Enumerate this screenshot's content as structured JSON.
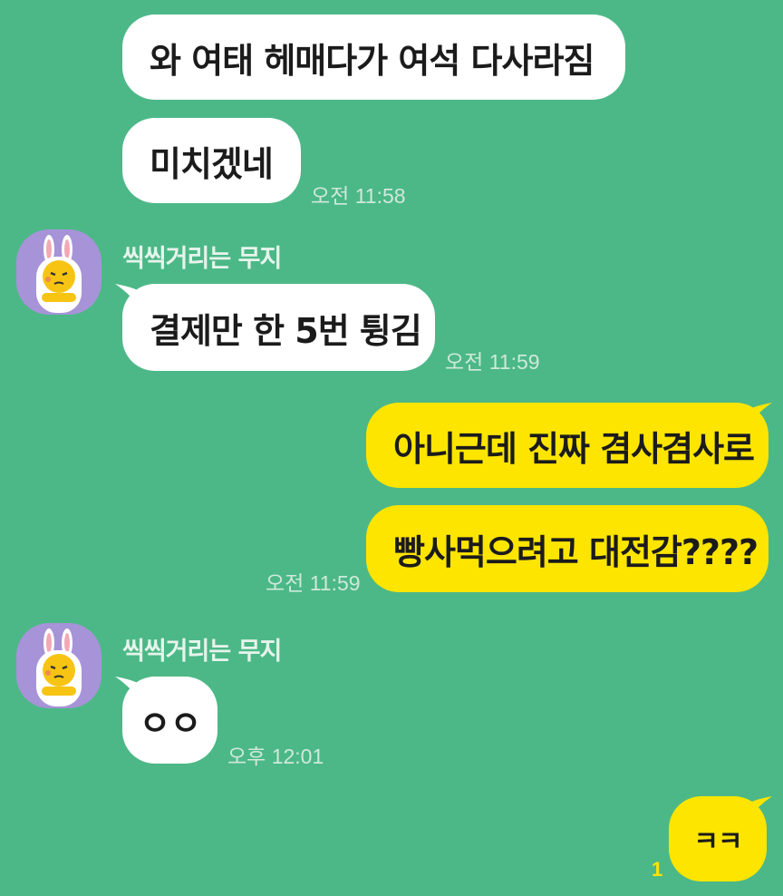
{
  "messages": [
    {
      "text": "와 여태 헤매다가 여석 다사라짐"
    },
    {
      "text": "미치겠네",
      "time": "오전 11:58"
    },
    {
      "sender": "씩씩거리는 무지",
      "text": "결제만 한 5번 튕김",
      "time": "오전 11:59"
    },
    {
      "text": "아니근데 진짜 겸사겸사로"
    },
    {
      "text": "빵사먹으려고 대전감????",
      "time": "오전 11:59"
    },
    {
      "sender": "씩씩거리는 무지",
      "text": "ㅇㅇ",
      "time": "오후 12:01"
    },
    {
      "text": "ㅋㅋ",
      "unread": "1"
    }
  ],
  "colors": {
    "background": "#4cb887",
    "incoming_bubble": "#ffffff",
    "outgoing_bubble": "#fde500",
    "avatar_bg": "#a793d8"
  },
  "icons": {
    "avatar": "muzi-avatar-icon"
  }
}
